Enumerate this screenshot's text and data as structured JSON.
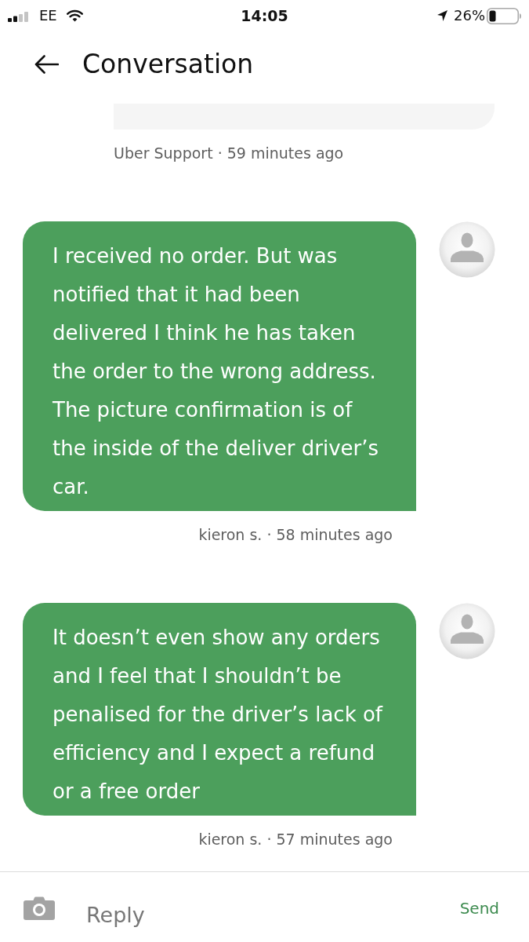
{
  "status_bar": {
    "carrier": "EE",
    "time": "14:05",
    "battery": "26%"
  },
  "header": {
    "title": "Conversation"
  },
  "messages": [
    {
      "kind": "incoming",
      "meta": "Uber Support · 59 minutes ago"
    },
    {
      "kind": "outgoing",
      "text": "I received no order. But was notified that it had been delivered I think he has taken the order to the wrong address. The picture confirmation is of the inside of the deliver driver’s car.",
      "meta": "kieron s. · 58 minutes ago"
    },
    {
      "kind": "outgoing",
      "text": "It doesn’t even show any orders and I feel that I shouldn’t be penalised for the driver’s lack of efficiency and I expect a refund or a free order",
      "meta": "kieron s. · 57 minutes ago"
    }
  ],
  "composer": {
    "placeholder": "Reply",
    "send": "Send"
  }
}
